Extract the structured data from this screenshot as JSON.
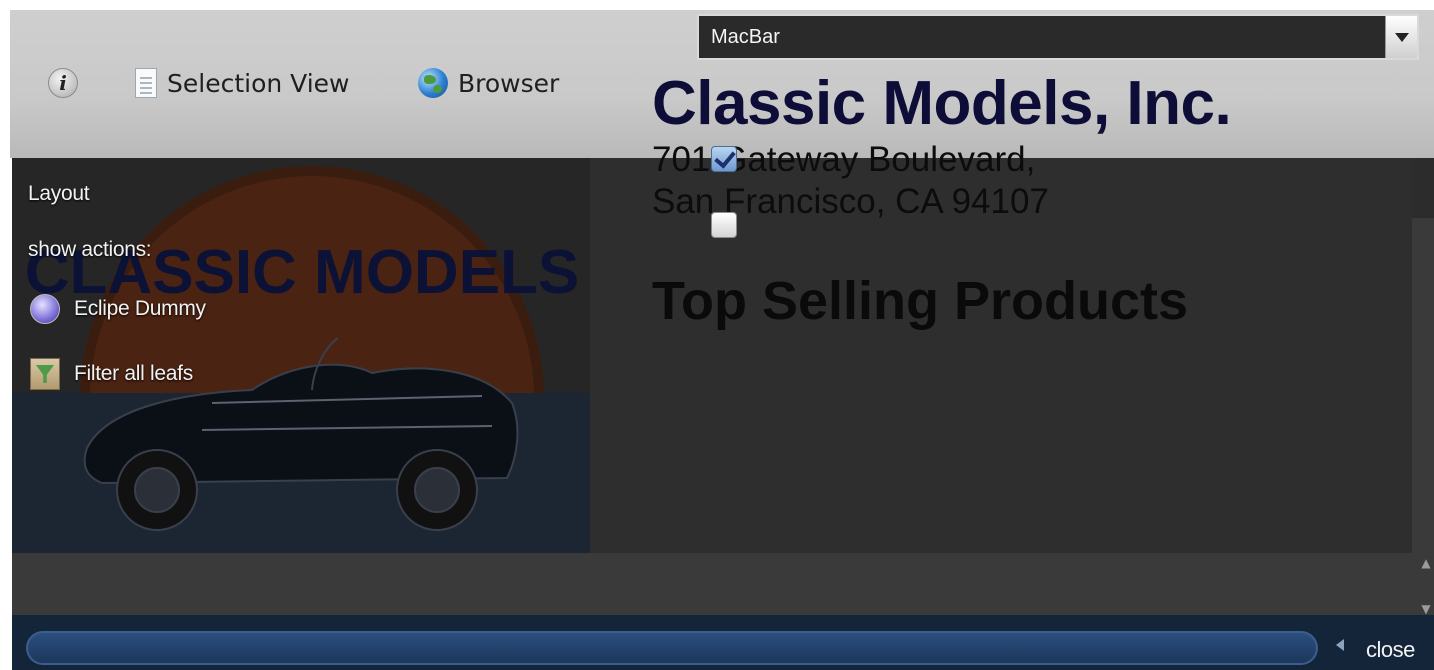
{
  "toolbar": {
    "info_icon": "info-icon",
    "selection_view_label": "Selection View",
    "browser_label": "Browser"
  },
  "left_panel": {
    "logo_text": "CLASSIC MODELS",
    "layout_label": "Layout",
    "show_actions_label": "show actions:",
    "actions": [
      {
        "label": "Eclipe Dummy",
        "icon": "eclipse-icon"
      },
      {
        "label": "Filter all leafs",
        "icon": "filter-icon"
      }
    ]
  },
  "layout_select": {
    "value": "MacBar"
  },
  "report": {
    "company": "Classic Models, Inc.",
    "address_line1": "701 Gateway Boulevard,",
    "address_line2": "San Francisco, CA 94107",
    "heading": "Top Selling Products"
  },
  "checkboxes": {
    "first_checked": true,
    "second_checked": false
  },
  "bottom": {
    "close_label": "close"
  },
  "colors": {
    "background_dark": "#2c2c2c",
    "toolbar": "#c9c9c9",
    "bottom_bar": "#142539",
    "company_text": "#0d0d38"
  }
}
